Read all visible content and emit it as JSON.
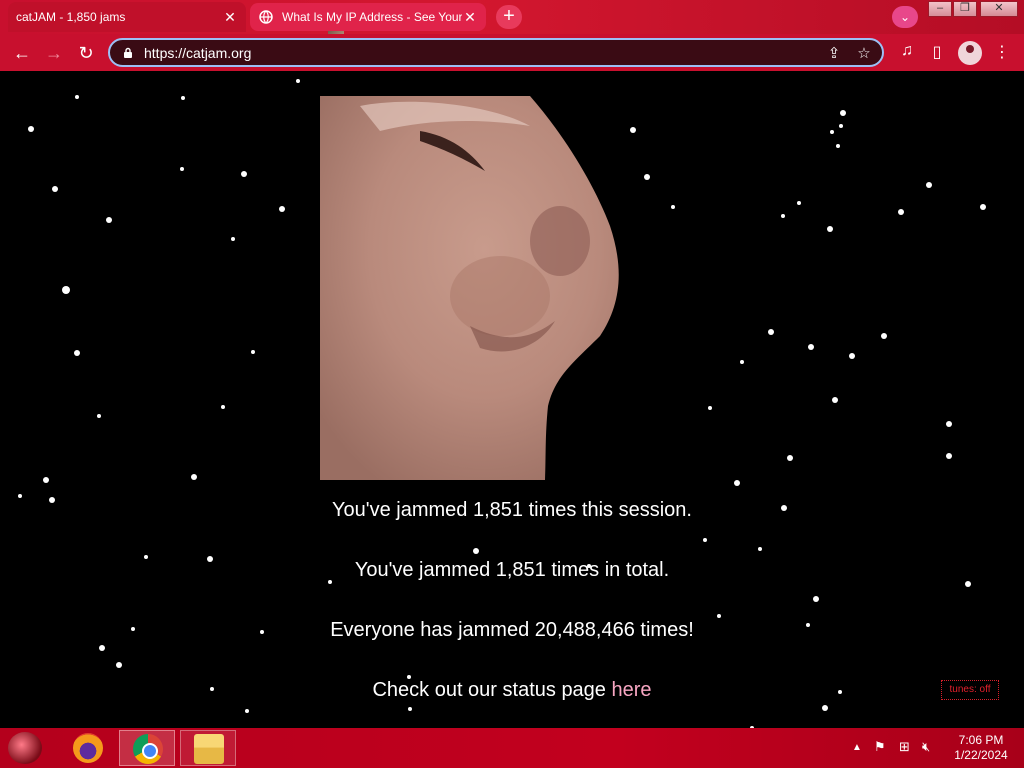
{
  "browser": {
    "tabs": [
      {
        "title": "catJAM - 1,850 jams",
        "active": true,
        "icon": "cat-favicon"
      },
      {
        "title": "What Is My IP Address - See Your",
        "active": false,
        "icon": "globe-icon"
      }
    ],
    "new_tab_label": "+",
    "address": "https://catjam.org",
    "accent_color": "#c8102e"
  },
  "page": {
    "session_text": "You've jammed 1,851 times this session.",
    "total_text": "You've jammed 1,851 times in total.",
    "everyone_text": "Everyone has jammed 20,488,466 times!",
    "status_prefix": "Check out our status page ",
    "status_link": "here",
    "tunes_label": "tunes: off"
  },
  "taskbar": {
    "apps": [
      "firefox",
      "chrome",
      "explorer"
    ],
    "time": "7:06 PM",
    "date": "1/22/2024"
  }
}
